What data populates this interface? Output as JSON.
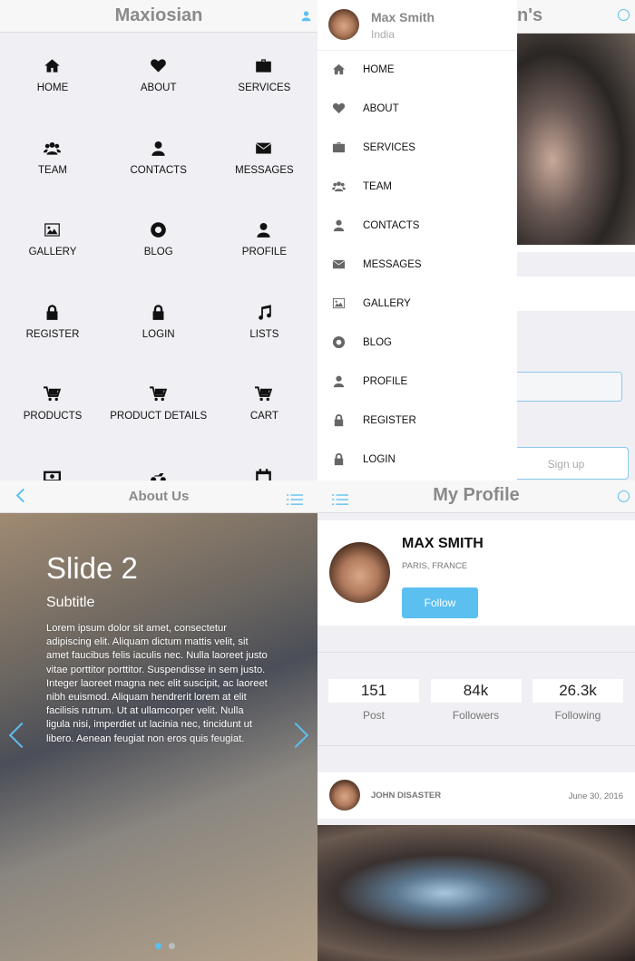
{
  "home": {
    "title": "Maxiosian",
    "icon": "user-icon",
    "items": [
      {
        "label": "HOME",
        "icon": "home"
      },
      {
        "label": "ABOUT",
        "icon": "heart"
      },
      {
        "label": "SERVICES",
        "icon": "briefcase"
      },
      {
        "label": "TEAM",
        "icon": "users"
      },
      {
        "label": "CONTACTS",
        "icon": "user"
      },
      {
        "label": "MESSAGES",
        "icon": "envelope"
      },
      {
        "label": "GALLERY",
        "icon": "image"
      },
      {
        "label": "BLOG",
        "icon": "lifebuoy"
      },
      {
        "label": "PROFILE",
        "icon": "user"
      },
      {
        "label": "REGISTER",
        "icon": "lock"
      },
      {
        "label": "LOGIN",
        "icon": "lock"
      },
      {
        "label": "LISTS",
        "icon": "music"
      },
      {
        "label": "PRODUCTS",
        "icon": "cart"
      },
      {
        "label": "PRODUCT DETAILS",
        "icon": "cart"
      },
      {
        "label": "CART",
        "icon": "cart"
      },
      {
        "label": "",
        "icon": "money"
      },
      {
        "label": "",
        "icon": "motorcycle"
      },
      {
        "label": "",
        "icon": "calendar"
      }
    ]
  },
  "drawer": {
    "user_name": "Max Smith",
    "user_location": "India",
    "items": [
      {
        "label": "HOME",
        "icon": "home"
      },
      {
        "label": "ABOUT",
        "icon": "heart"
      },
      {
        "label": "SERVICES",
        "icon": "briefcase"
      },
      {
        "label": "TEAM",
        "icon": "users"
      },
      {
        "label": "CONTACTS",
        "icon": "user"
      },
      {
        "label": "MESSAGES",
        "icon": "envelope"
      },
      {
        "label": "GALLERY",
        "icon": "image"
      },
      {
        "label": "BLOG",
        "icon": "lifebuoy"
      },
      {
        "label": "PROFILE",
        "icon": "user"
      },
      {
        "label": "REGISTER",
        "icon": "lock"
      },
      {
        "label": "LOGIN",
        "icon": "lock"
      }
    ],
    "behind_title_fragment": "n's",
    "behind_button": "Sign up"
  },
  "about": {
    "title": "About Us",
    "slide_title": "Slide 2",
    "slide_subtitle": "Subtitle",
    "slide_text": "Lorem ipsum dolor sit amet, consectetur adipiscing elit. Aliquam dictum mattis velit, sit amet faucibus felis iaculis nec. Nulla laoreet justo vitae porttitor porttitor. Suspendisse in sem justo. Integer laoreet magna nec elit suscipit, ac laoreet nibh euismod. Aliquam hendrerit lorem at elit facilisis rutrum. Ut at ullamcorper velit. Nulla ligula nisi, imperdiet ut lacinia nec, tincidunt ut libero. Aenean feugiat non eros quis feugiat.",
    "active_slide": 2,
    "slide_count": 2
  },
  "profile": {
    "title": "My Profile",
    "name": "MAX SMITH",
    "location": "PARIS, FRANCE",
    "follow_label": "Follow",
    "stats": [
      {
        "value": "151",
        "label": "Post"
      },
      {
        "value": "84k",
        "label": "Followers"
      },
      {
        "value": "26.3k",
        "label": "Following"
      }
    ],
    "post": {
      "author": "JOHN DISASTER",
      "date": "June 30, 2016"
    }
  },
  "colors": {
    "accent": "#5bc0f0",
    "header_text": "#8a8a8a",
    "background": "#efeff4"
  }
}
